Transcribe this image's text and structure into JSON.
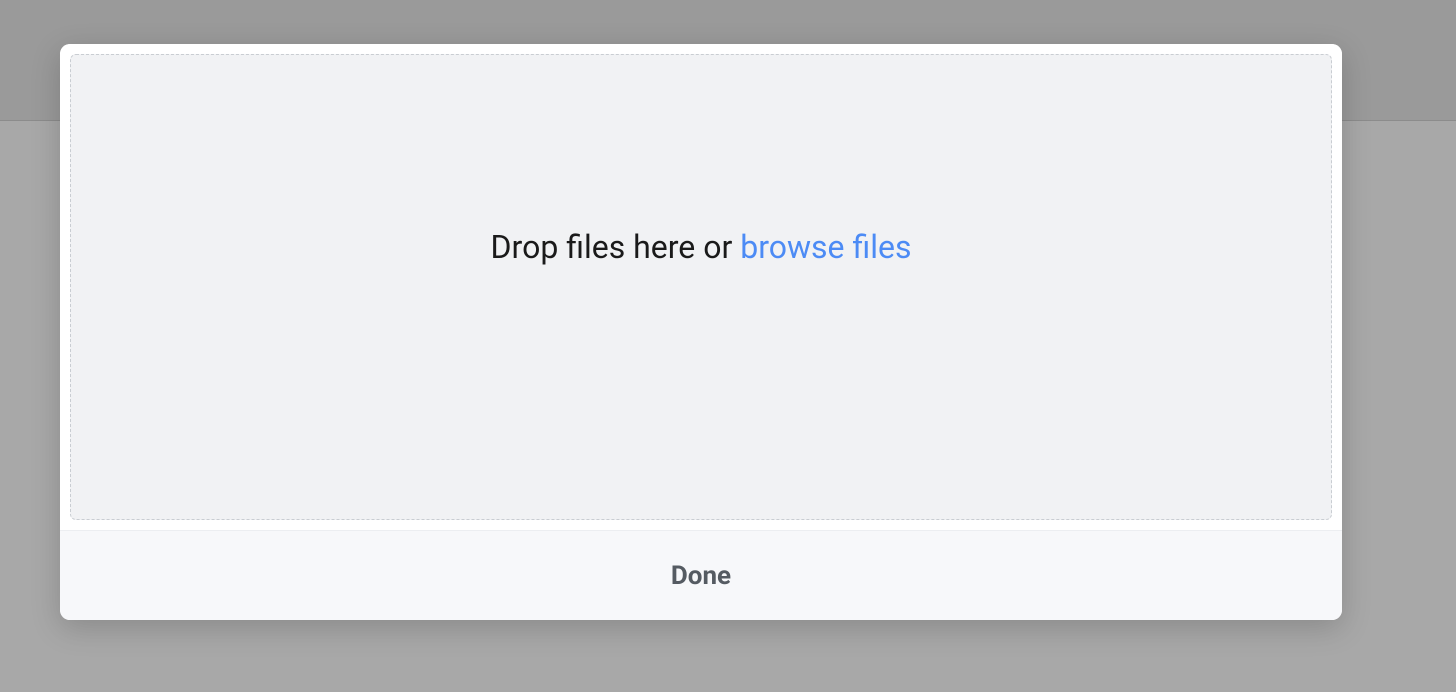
{
  "modal": {
    "dropzone": {
      "prompt_prefix": "Drop files here or ",
      "browse_label": "browse files"
    },
    "footer": {
      "done_label": "Done"
    }
  }
}
